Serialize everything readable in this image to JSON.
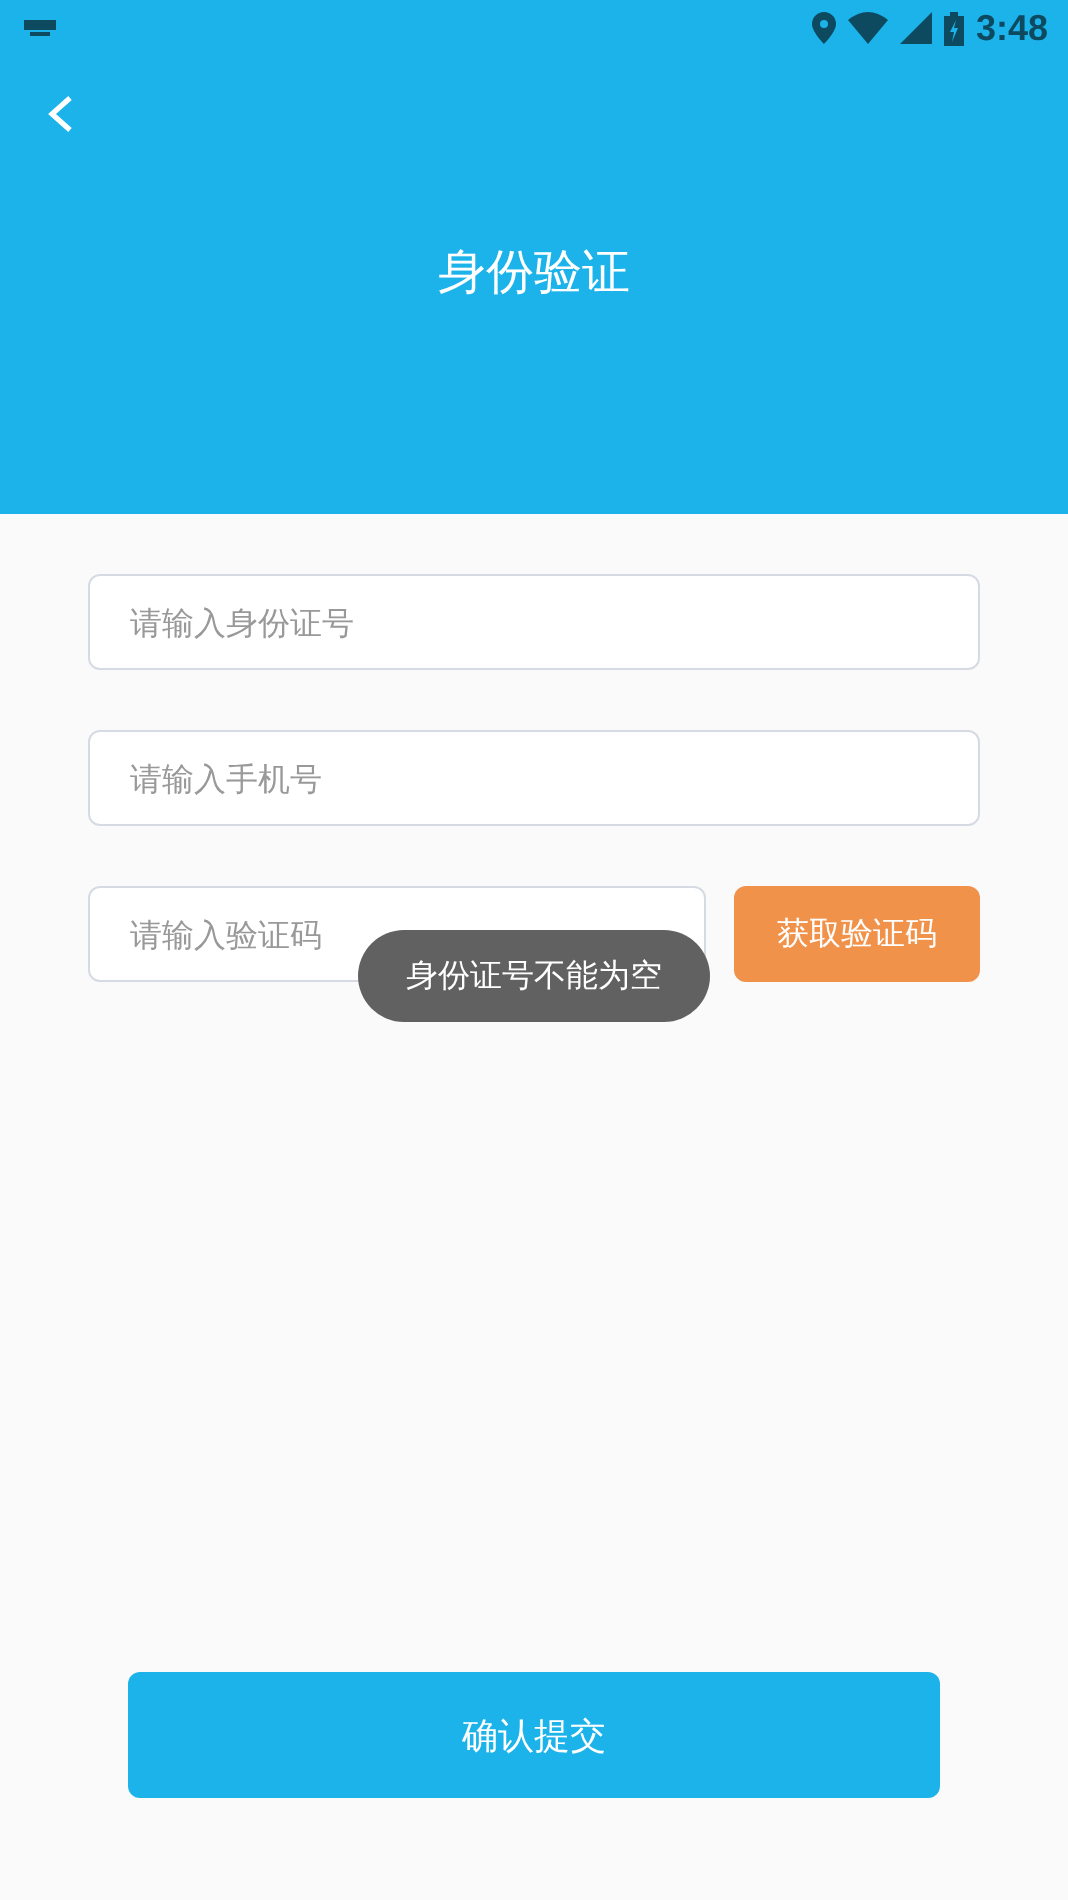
{
  "status_bar": {
    "time": "3:48"
  },
  "header": {
    "title": "身份验证"
  },
  "fields": [
    {
      "placeholder": "请输入身份证号"
    },
    {
      "placeholder": "请输入手机号"
    }
  ],
  "code_field": {
    "placeholder": "请输入验证码",
    "button": "获取验证码"
  },
  "toast": "身份证号不能为空",
  "submit_button": "确认提交"
}
